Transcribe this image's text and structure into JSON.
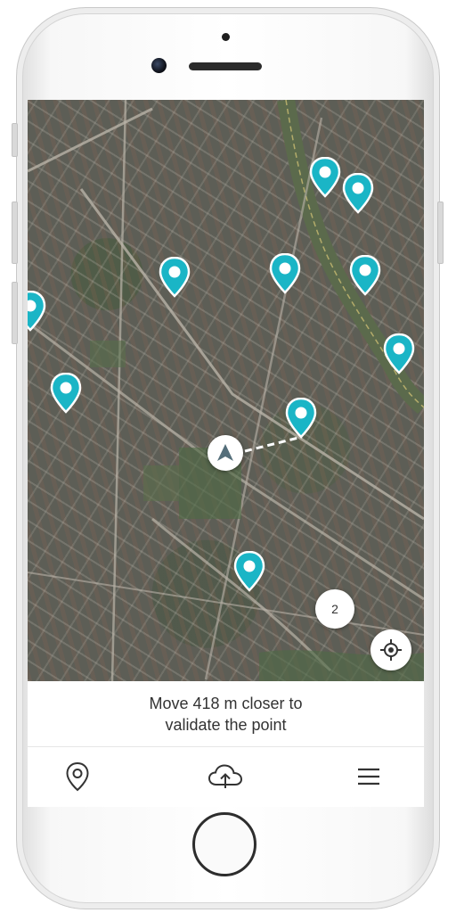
{
  "message": {
    "line1": "Move 418 m closer to",
    "line2": "validate the point"
  },
  "map": {
    "cluster_count": "2",
    "marker_color": "#1ab5c6",
    "points_visible": 11
  },
  "bottom_nav": [
    {
      "name": "points",
      "icon": "map-pin-icon"
    },
    {
      "name": "upload",
      "icon": "cloud-upload-icon"
    },
    {
      "name": "menu",
      "icon": "hamburger-menu-icon"
    }
  ],
  "colors": {
    "accent": "#1ab5c6",
    "text": "#333333",
    "map_base": "#5d5e56"
  }
}
